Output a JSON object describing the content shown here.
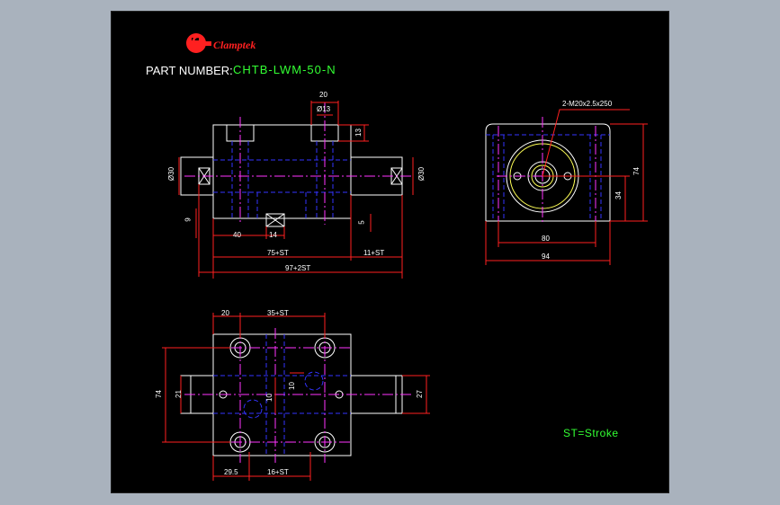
{
  "brand": {
    "name": "Clamptek",
    "logo_letter": "G",
    "logo_color": "#ff2020"
  },
  "part_number": {
    "label": "PART NUMBER:",
    "value": "CHTB-LWM-50-N"
  },
  "legend": "ST=Stroke",
  "colors": {
    "outline": "#ffffff",
    "hidden": "#3333ff",
    "center": "#ff33ff",
    "dimension": "#ff2020",
    "dim_text": "#ffffff",
    "green_text": "#33ff33",
    "frame_bg": "#000000",
    "viewport_bg": "#a9b2bd"
  },
  "dims": {
    "front": {
      "top_20": "20",
      "dia13": "Ø13",
      "h13": "13",
      "dia30_left": "Ø30",
      "dia30_right": "Ø30",
      "h9": "9",
      "h5": "5",
      "w40": "40",
      "w14": "14",
      "w75st": "75+ST",
      "w11st": "11+ST",
      "w97st": "97+2ST"
    },
    "side": {
      "thread": "2-M20x2.5x250",
      "h74": "74",
      "h34": "34",
      "w80": "80",
      "w94": "94"
    },
    "top": {
      "w20": "20",
      "w35st": "35+ST",
      "h74": "74",
      "h21": "21",
      "v10a": "10",
      "v10b": "10",
      "h27": "27",
      "w295": "29.5",
      "w16st": "16+ST"
    }
  }
}
